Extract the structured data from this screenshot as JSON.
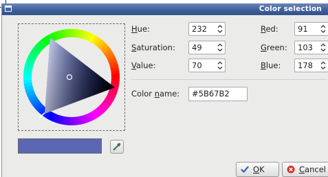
{
  "window": {
    "title": "Color selection"
  },
  "fields": {
    "hue": {
      "label_u": "H",
      "label_rest": "ue:",
      "value": "232"
    },
    "saturation": {
      "label_u": "S",
      "label_rest": "aturation:",
      "value": "49"
    },
    "value": {
      "label_u": "V",
      "label_rest": "alue:",
      "value": "70"
    },
    "red": {
      "label_u": "R",
      "label_rest": "ed:",
      "value": "91"
    },
    "green": {
      "label_u": "G",
      "label_rest": "reen:",
      "value": "103"
    },
    "blue": {
      "label_u": "B",
      "label_rest": "lue:",
      "value": "178"
    }
  },
  "color_name": {
    "label_before": "Color ",
    "label_u": "n",
    "label_rest": "ame:",
    "value": "#5B67B2"
  },
  "current_color": "#5B67B2",
  "buttons": {
    "ok": {
      "label_u": "O",
      "label_rest": "K",
      "icon": "checkmark-icon"
    },
    "cancel": {
      "label_u": "C",
      "label_rest": "ancel",
      "icon": "cancel-icon"
    }
  },
  "icons": {
    "window": "window-icon",
    "picker": "eyedropper-icon"
  }
}
